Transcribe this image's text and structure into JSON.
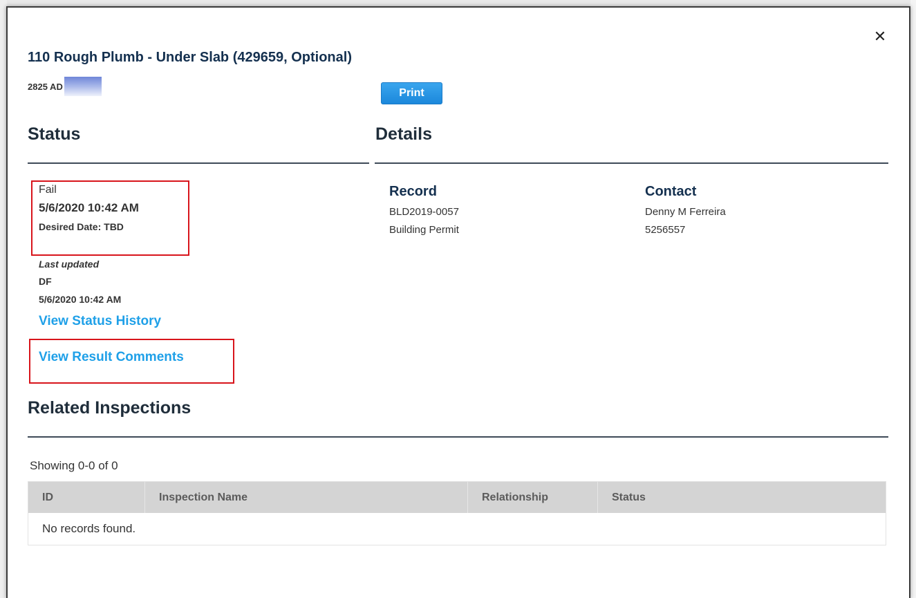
{
  "modal": {
    "close_glyph": "✕",
    "title": "110 Rough Plumb - Under Slab (429659, Optional)",
    "address_visible": "2825 AD",
    "print_label": "Print"
  },
  "status": {
    "heading": "Status",
    "result": "Fail",
    "result_datetime": "5/6/2020 10:42 AM",
    "desired_date": "Desired Date: TBD",
    "last_updated_label": "Last updated",
    "last_updated_by": "DF",
    "last_updated_datetime": "5/6/2020 10:42 AM",
    "view_history_link": "View Status History",
    "view_comments_link": "View Result Comments"
  },
  "details": {
    "heading": "Details",
    "record_label": "Record",
    "record_number": "BLD2019-0057",
    "record_type": "Building Permit",
    "contact_label": "Contact",
    "contact_name": "Denny M Ferreira",
    "contact_phone": "5256557"
  },
  "related": {
    "heading": "Related Inspections",
    "showing_text": "Showing 0-0 of 0",
    "columns": [
      "ID",
      "Inspection Name",
      "Relationship",
      "Status"
    ],
    "empty_text": "No records found."
  },
  "colors": {
    "title_navy": "#14304f",
    "link_blue": "#1fa0e8",
    "print_blue": "#1c88db",
    "highlight_red": "#d8141b"
  }
}
